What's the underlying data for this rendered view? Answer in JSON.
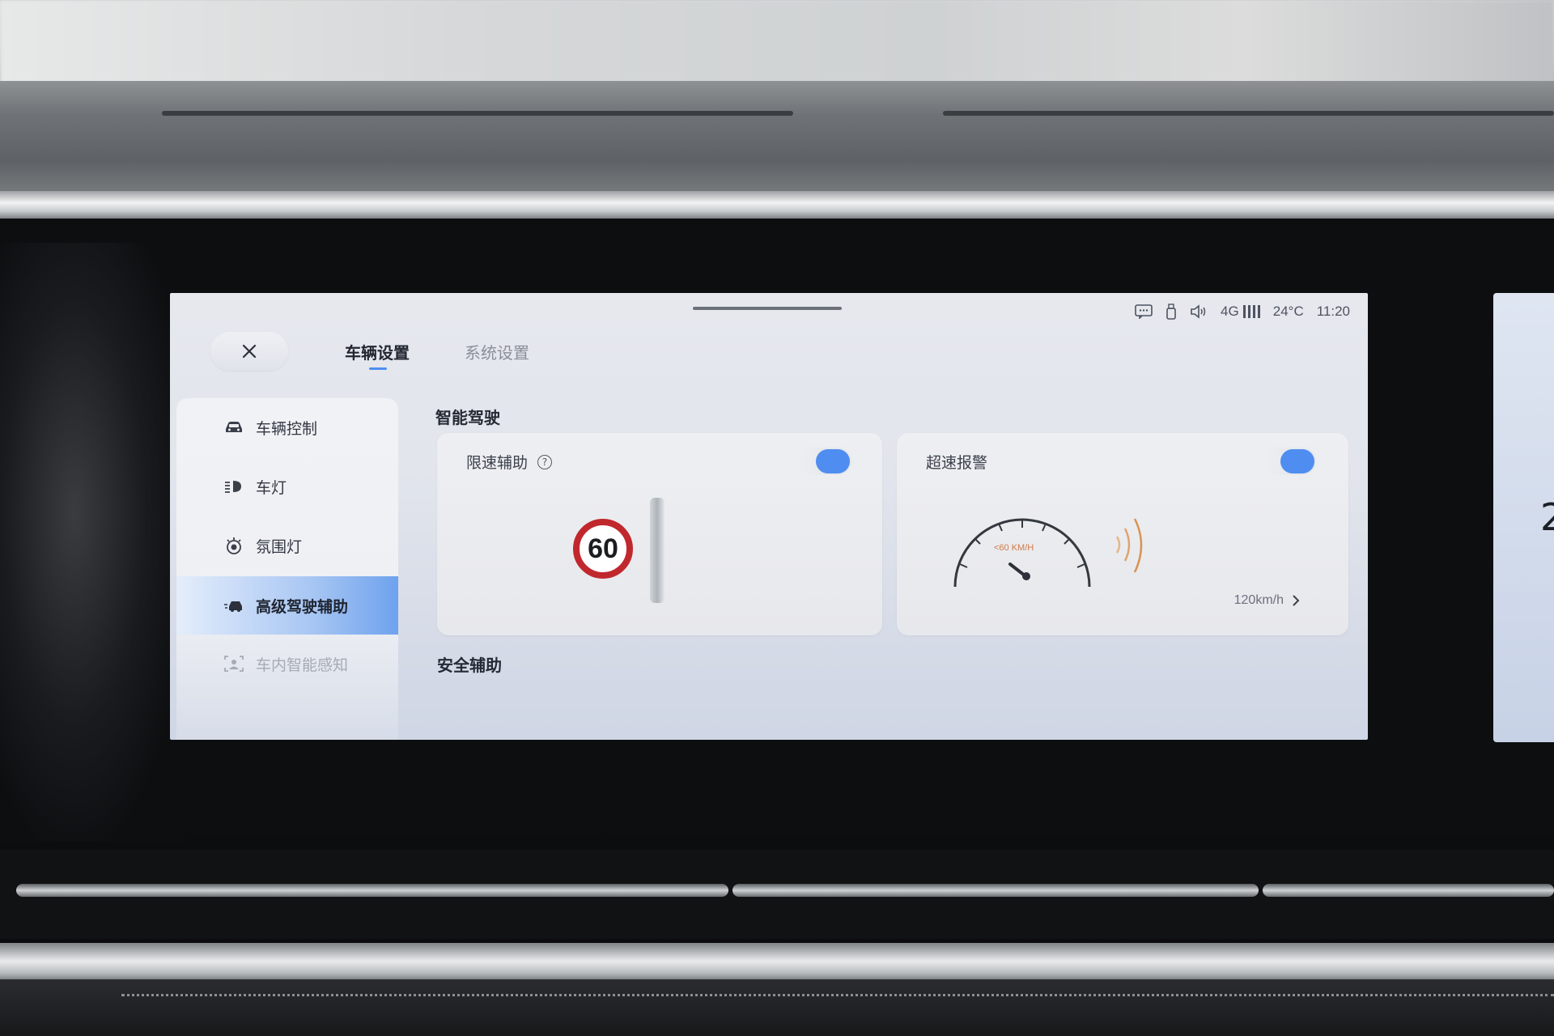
{
  "status_bar": {
    "network": "4G",
    "temperature": "24°C",
    "time": "11:20",
    "icons": [
      "message-icon",
      "usb-icon",
      "volume-icon",
      "signal-icon"
    ]
  },
  "tabs": [
    {
      "label": "车辆设置",
      "active": true
    },
    {
      "label": "系统设置",
      "active": false
    }
  ],
  "sidebar": {
    "items": [
      {
        "label": "车辆控制",
        "icon": "car-icon",
        "selected": false
      },
      {
        "label": "车灯",
        "icon": "headlight-icon",
        "selected": false
      },
      {
        "label": "氛围灯",
        "icon": "ambient-light-icon",
        "selected": false
      },
      {
        "label": "高级驾驶辅助",
        "icon": "driver-assist-icon",
        "selected": true
      },
      {
        "label": "车内智能感知",
        "icon": "cabin-sensing-icon",
        "selected": false
      }
    ]
  },
  "main": {
    "section_smart_driving": "智能驾驶",
    "section_safety": "安全辅助",
    "cards": [
      {
        "title": "限速辅助",
        "toggle_on": true,
        "sign_value": "60"
      },
      {
        "title": "超速报警",
        "toggle_on": true,
        "gauge_label": "<60 KM/H",
        "speed_value": "120km/h"
      }
    ]
  },
  "side_screen": {
    "glyph": "2"
  },
  "colors": {
    "accent": "#4f8ef0",
    "sign_red": "#c0282e",
    "warning_orange": "#d9934f"
  }
}
